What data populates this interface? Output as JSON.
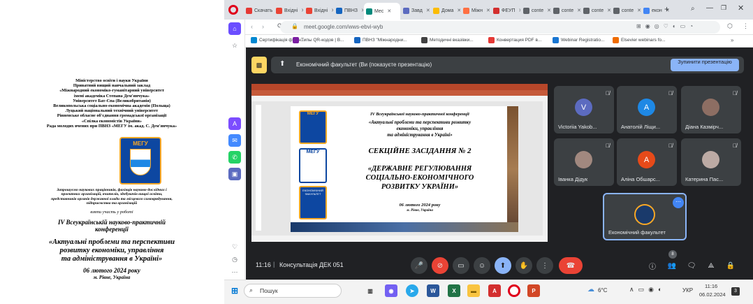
{
  "document": {
    "lines": [
      "Міністерство освіти і науки України",
      "Приватний вищий навчальний заклад",
      "«Міжнародний економіко-гуманітарний університет",
      "імені академіка Степана Дем'янчука»",
      "Університет Бат-Спа (Великобританія)",
      "Великопольська соціально-економічна академія (Польща)",
      "Луцький національний технічний університет",
      "Рівненське обласне об'єднання громадської організації",
      "«Спілка економістів України»",
      "Рада молодих вчених при ПВНЗ «МЕГУ ім. акад. С. Дем'янчука»"
    ],
    "logo_text": "МЕГУ",
    "invite_lines": [
      "Запрошуємо наукових працівників, фахівців науково-дослідних і",
      "проектних організацій, вчителів, здобувачів вищої освіти,",
      "представників органів державної влади та місцевого самоврядування,",
      "підприємства та організацій"
    ],
    "participate": "взяти участь у роботі",
    "conf_title": [
      "IV Всеукраїнській науково-практичній",
      "конференції"
    ],
    "topic": [
      "«Актуальні проблеми та перспективи",
      "розвитку економіки, управління",
      "та адміністрування в Україні»"
    ],
    "date": "06 лютого 2024 року",
    "city": "м. Рівне, Україна"
  },
  "tabs": [
    {
      "label": "Скачать",
      "color": "#e53935"
    },
    {
      "label": "Вхідні",
      "color": "#ea4335"
    },
    {
      "label": "Вхідні",
      "color": "#ea4335"
    },
    {
      "label": "ПВНЗ",
      "color": "#1565c0"
    },
    {
      "label": "Мес",
      "color": "#00897b",
      "active": true
    },
    {
      "label": "Завд",
      "color": "#5c6bc0"
    },
    {
      "label": "Дома",
      "color": "#fbbc04"
    },
    {
      "label": "Міжн",
      "color": "#ff7043"
    },
    {
      "label": "ФЕУП",
      "color": "#d32f2f"
    },
    {
      "label": "conte",
      "color": "#5f6368"
    },
    {
      "label": "conte",
      "color": "#5f6368"
    },
    {
      "label": "conte",
      "color": "#5f6368"
    },
    {
      "label": "conte",
      "color": "#5f6368"
    },
    {
      "label": "екон",
      "color": "#4285f4"
    }
  ],
  "url": "meet.google.com/wws-ebvi-wyb",
  "bookmarks": [
    {
      "label": "Сертифікація фінан...",
      "color": "#0288d1"
    },
    {
      "label": "Типы QR-кодов | B...",
      "color": "#7b1fa2"
    },
    {
      "label": "ПВНЗ \"Міжнародни...",
      "color": "#1565c0"
    },
    {
      "label": "Методичні вказівки...",
      "color": "#424242"
    },
    {
      "label": "Конвертация PDF в...",
      "color": "#e53935"
    },
    {
      "label": "Webinar Registratio...",
      "color": "#1976d2"
    },
    {
      "label": "Elsevier webinars fo...",
      "color": "#ef6c00"
    }
  ],
  "meet": {
    "banner_text": "Економічний факультет (Ви (показуєте презентацію)",
    "stop_button": "Зупинити презентацію",
    "time": "11:16",
    "meeting_name": "Консультація ДЕК 051",
    "people_count": "8",
    "participants": [
      {
        "name": "Victoriia Yakob...",
        "initial": "V",
        "color": "#5c6bc0"
      },
      {
        "name": "Анатолій Ліщи...",
        "initial": "А",
        "color": "#1e88e5"
      },
      {
        "name": "Діана Казмірч...",
        "initial": "",
        "color": "#8d6e63",
        "photo": true
      },
      {
        "name": "Іванка Дідук",
        "initial": "",
        "color": "#a1887f",
        "photo": true
      },
      {
        "name": "Аліна Обшарс...",
        "initial": "А",
        "color": "#e64a19"
      },
      {
        "name": "Катерина Пас...",
        "initial": "",
        "color": "#bcaaa4",
        "photo": true
      }
    ],
    "self_tile": "Економічний факультет"
  },
  "slide": {
    "conf": "IV Всеукраїнської науково-практичної конференції",
    "topic": [
      "«Актуальні проблеми та перспективи розвитку",
      "економіки, управління",
      "та адміністрування в Україні»"
    ],
    "section": "СЕКЦІЙНЕ ЗАСІДАННЯ № 2",
    "title": [
      "«ДЕРЖАВНЕ РЕГУЛЮВАННЯ",
      "СОЦІАЛЬНО-ЕКОНОМІЧНОГО",
      "РОЗВИТКУ УКРАЇНИ»"
    ],
    "date": "06 лютого 2024 року",
    "city": "м. Рівне, Україна",
    "logo1": "МЕГУ",
    "logo2": "МЕГУ",
    "logo3": "ЕКОНОМІЧНИЙ ФАКУЛЬТЕТ"
  },
  "taskbar": {
    "search": "Пошук",
    "weather": "6°C",
    "lang": "УКР",
    "time": "11:16",
    "date": "06.02.2024",
    "notif": "3"
  }
}
